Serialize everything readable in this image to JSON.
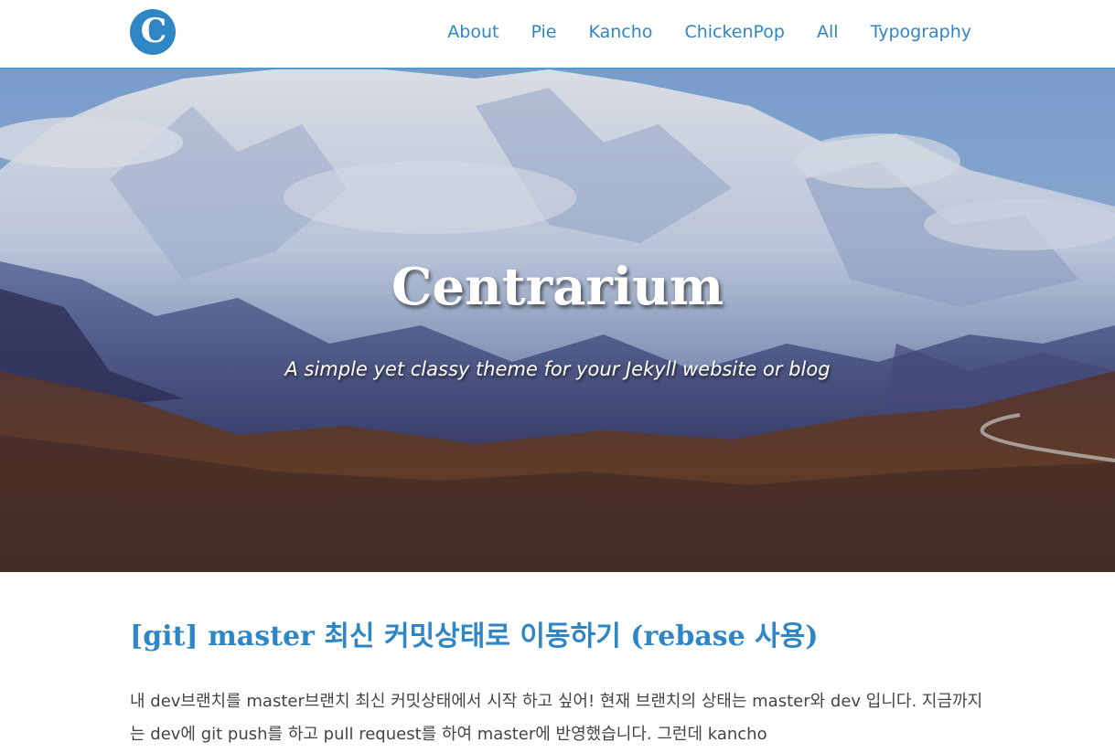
{
  "header": {
    "logo_letter": "C",
    "nav": [
      "About",
      "Pie",
      "Kancho",
      "ChickenPop",
      "All",
      "Typography"
    ]
  },
  "hero": {
    "title": "Centrarium",
    "subtitle": "A simple yet classy theme for your Jekyll website or blog"
  },
  "post": {
    "title": "[git] master 최신 커밋상태로 이동하기 (rebase 사용)",
    "excerpt": "내 dev브랜치를 master브랜치 최신 커밋상태에서 시작 하고 싶어! 현재 브랜치의 상태는 master와 dev 입니다. 지금까지는 dev에 git push를 하고 pull request를 하여 master에 반영했습니다. 그런데 kancho"
  },
  "colors": {
    "accent": "#2f86c4",
    "header_border": "#4aa0d6",
    "body_text": "#444444"
  }
}
